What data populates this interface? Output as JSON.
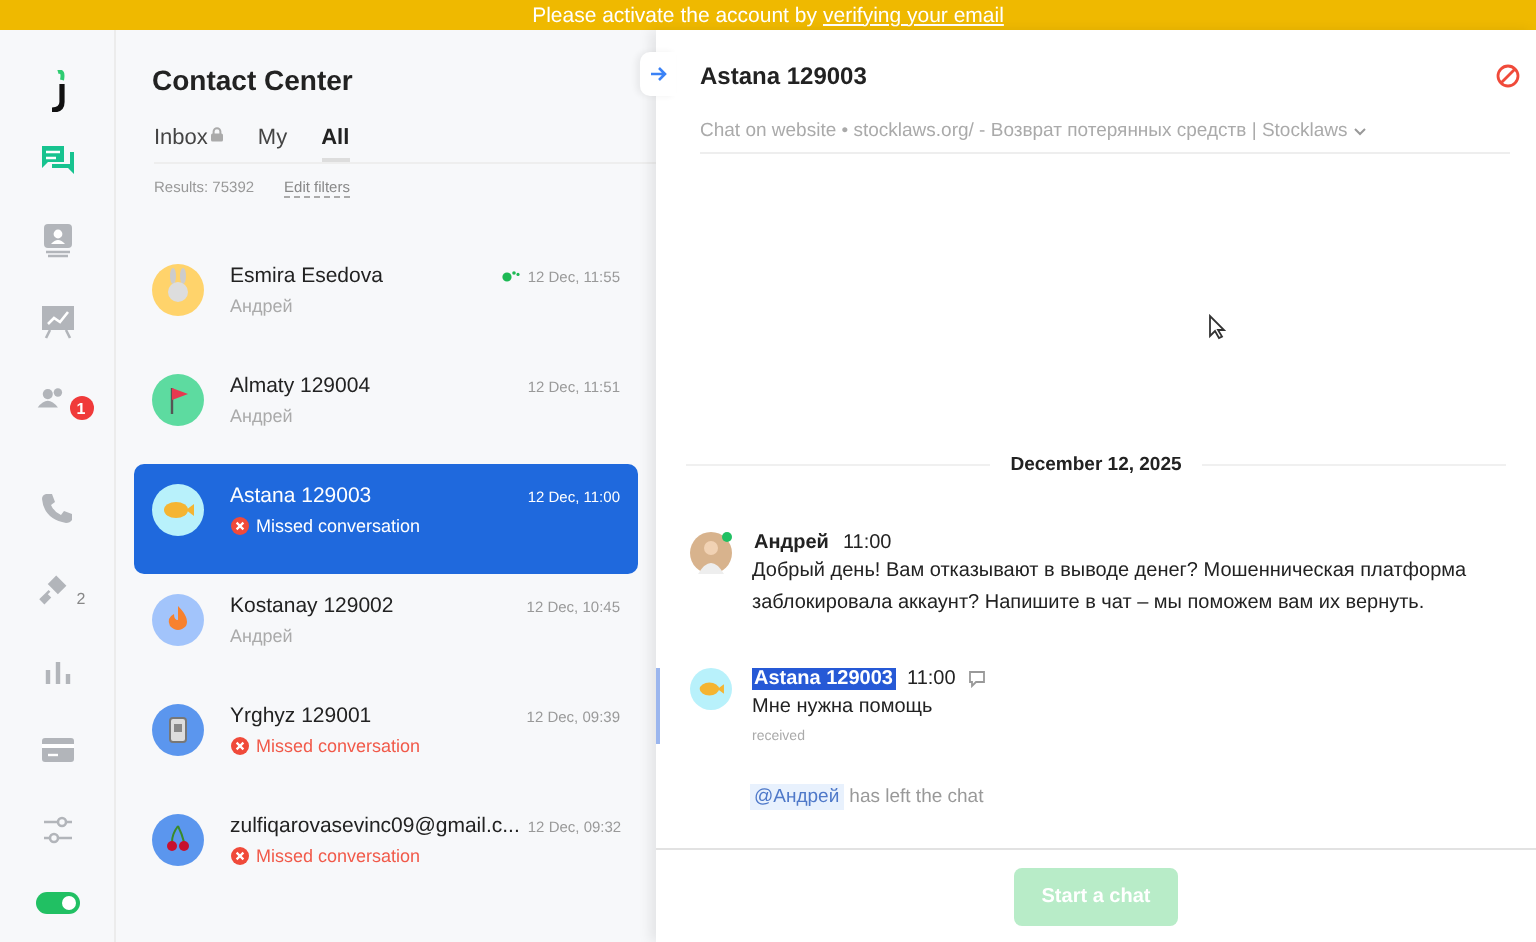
{
  "banner": {
    "text": "Please activate the account by",
    "link": "verifying your email"
  },
  "rail": {
    "items": [
      {
        "kind": "chats",
        "selected": true
      },
      {
        "kind": "contacts",
        "selected": false
      },
      {
        "kind": "reports",
        "selected": false
      },
      {
        "kind": "team",
        "selected": false,
        "badge": "1"
      },
      {
        "kind": "phone",
        "selected": false
      },
      {
        "kind": "integrations",
        "selected": false,
        "badge": "2"
      },
      {
        "kind": "analytics",
        "selected": false
      },
      {
        "kind": "billing",
        "selected": false
      },
      {
        "kind": "settings",
        "selected": false
      }
    ],
    "status_toggle": {
      "on": true
    }
  },
  "list": {
    "title": "Contact Center",
    "tabs": [
      {
        "label": "Inbox",
        "locked": true,
        "selected": false
      },
      {
        "label": "My",
        "locked": false,
        "selected": false
      },
      {
        "label": "All",
        "locked": false,
        "selected": true
      }
    ],
    "results": "Results: 75392",
    "edit_filters": "Edit filters",
    "conversations": [
      {
        "name": "Esmira Esedova",
        "time": "12 Dec, 11:55",
        "kind": "agent",
        "subtitle": "Андрей",
        "typing": true,
        "selected": false,
        "color": "#ffd36b"
      },
      {
        "name": "Almaty 129004",
        "time": "12 Dec, 11:51",
        "kind": "agent",
        "subtitle": "Андрей",
        "typing": false,
        "selected": false,
        "color": "#5ddba0"
      },
      {
        "name": "Astana 129003",
        "time": "12 Dec, 11:00",
        "kind": "missed",
        "subtitle": "Missed conversation",
        "typing": false,
        "selected": true,
        "color": "#b8f1fb"
      },
      {
        "name": "Kostanay 129002",
        "time": "12 Dec, 10:45",
        "kind": "agent",
        "subtitle": "Андрей",
        "typing": false,
        "selected": false,
        "color": "#a2c4fb"
      },
      {
        "name": "Yrghyz 129001",
        "time": "12 Dec, 09:39",
        "kind": "missed",
        "subtitle": "Missed conversation",
        "typing": false,
        "selected": false,
        "color": "#5b96ee"
      },
      {
        "name": "zulfiqarovasevinc09@gmail.c...",
        "time": "12 Dec, 09:32",
        "kind": "missed",
        "subtitle": "Missed conversation",
        "typing": false,
        "selected": false,
        "color": "#5b96ee"
      }
    ]
  },
  "chat": {
    "title": "Astana 129003",
    "subtitle": "Chat on website • stocklaws.org/ - Возврат потерянных средств | Stocklaws",
    "date": "December 12, 2025",
    "messages": [
      {
        "kind": "agent",
        "author": "Андрей",
        "time": "11:00",
        "text": "Добрый день! Вам отказывают в выводе денег? Мошенническая платформа заблокировала аккаунт? Напишите в чат – мы поможем вам их вернуть.",
        "online": true
      },
      {
        "kind": "customer",
        "author": "Astana 129003",
        "time": "11:00",
        "text": "Мне нужна помощь",
        "status": "received",
        "highlighted": true
      },
      {
        "kind": "system",
        "mention": "@Андрей",
        "text": "has left the chat"
      }
    ],
    "button": {
      "label": "Start a chat",
      "disabled": true
    }
  }
}
